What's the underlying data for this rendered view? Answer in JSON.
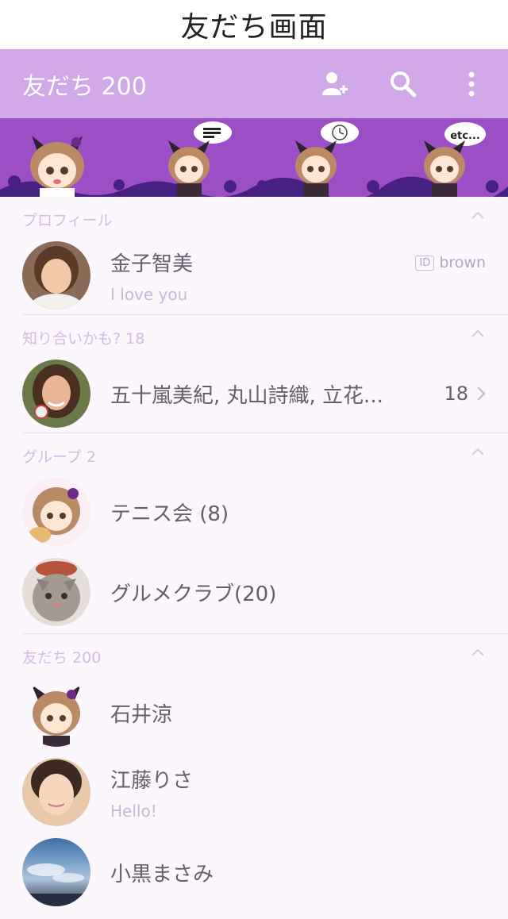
{
  "caption": "友だち画面",
  "header": {
    "title": "友だち 200",
    "bg_color": "#d0a8e8",
    "icons": [
      "add-friend-icon",
      "search-icon",
      "more-vertical-icon"
    ]
  },
  "banner": {
    "bg_color": "#9c4ec4",
    "bubble_text_etc": "etc..."
  },
  "profile": {
    "section_label": "プロフィール",
    "name": "金子智美",
    "status": "I love you",
    "id_label": "ID",
    "id_value": "brown"
  },
  "suggestions": {
    "section_label": "知り合いかも? 18",
    "names": "五十嵐美紀, 丸山詩織, 立花...",
    "count": "18"
  },
  "groups": {
    "section_label": "グループ  2",
    "items": [
      {
        "name": "テニス会 (8)"
      },
      {
        "name": "グルメクラブ(20)"
      }
    ]
  },
  "friends": {
    "section_label": "友だち 200",
    "items": [
      {
        "name": "石井涼",
        "status": ""
      },
      {
        "name": "江藤りさ",
        "status": "Hello!"
      },
      {
        "name": "小黒まさみ",
        "status": ""
      }
    ]
  }
}
